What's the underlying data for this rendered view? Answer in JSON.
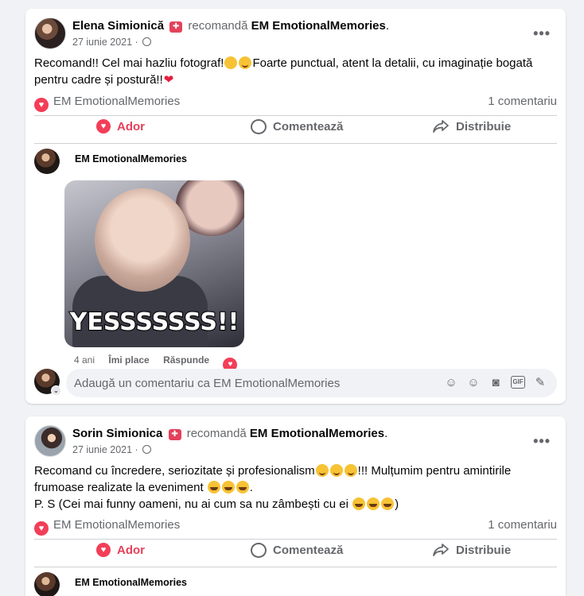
{
  "posts": [
    {
      "author": "Elena Simionică",
      "recommends_word": "recomandă",
      "page": "EM EmotionalMemories",
      "date": "27 iunie 2021 ·",
      "text_parts": [
        "Recomand!! Cel mai hazliu fotograf!",
        "Foarte punctual, atent la detalii, cu imaginație bogată pentru cadre și postură!!"
      ],
      "reaction_name": "EM EmotionalMemories",
      "comment_count": "1 comentariu",
      "comment": {
        "name": "EM EmotionalMemories",
        "gif_text": "YESSSSSSS!!",
        "age": "4 ani",
        "like_label": "Îmi place",
        "reply_label": "Răspunde"
      },
      "composer_placeholder": "Adaugă un comentariu ca EM EmotionalMemories"
    },
    {
      "author": "Sorin Simionica",
      "recommends_word": "recomandă",
      "page": "EM EmotionalMemories",
      "date": "27 iunie 2021 ·",
      "text_parts": [
        "Recomand cu încredere, seriozitate și profesionalism",
        "!!! Mulțumim pentru amintirile frumoase realizate la eveniment",
        ".",
        "P. S (Cei mai funny oameni, nu ai cum sa nu zâmbești cu ei"
      ],
      "reaction_name": "EM EmotionalMemories",
      "comment_count": "1 comentariu",
      "comment": {
        "name": "EM EmotionalMemories"
      }
    }
  ],
  "actions": {
    "like": "Ador",
    "comment": "Comentează",
    "share": "Distribuie"
  },
  "colors": {
    "love": "#e4415a",
    "secondary_text": "#65676b",
    "background": "#f0f2f5"
  },
  "icons": [
    "more-options-icon",
    "globe-icon",
    "recommend-icon",
    "heart-reaction-icon",
    "comment-icon",
    "share-icon",
    "avatar-sticker-icon",
    "emoji-icon",
    "camera-icon",
    "gif-icon",
    "sticker-icon"
  ]
}
